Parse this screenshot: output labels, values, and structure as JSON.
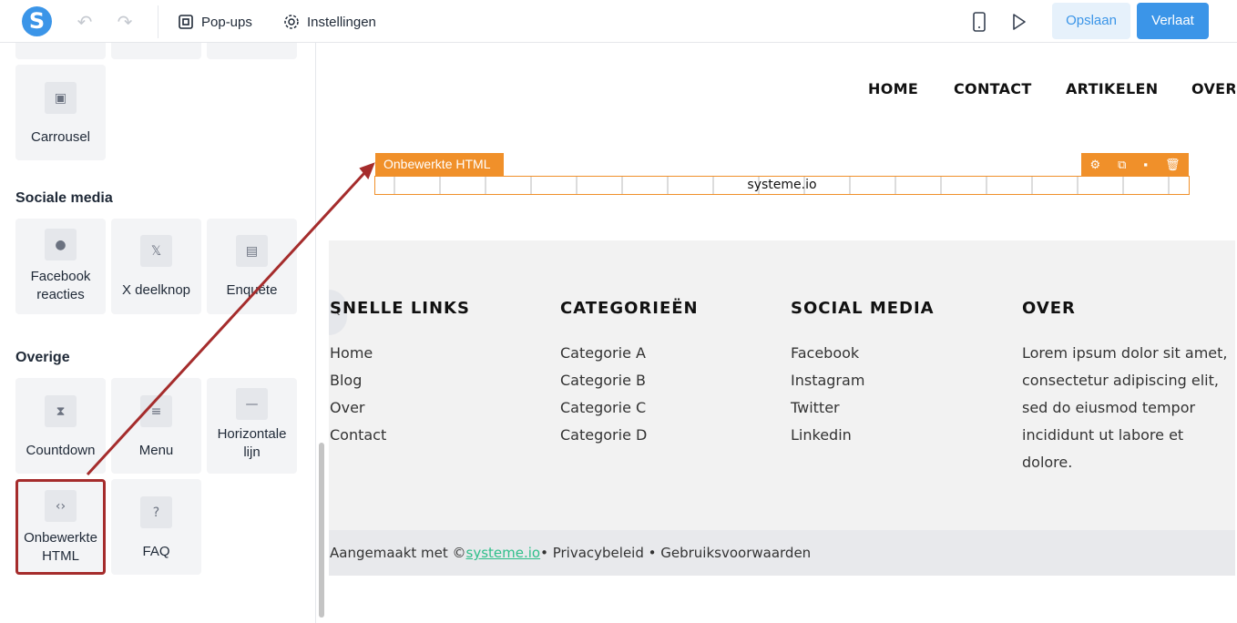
{
  "topbar": {
    "logo_letter": "S",
    "popups_label": "Pop-ups",
    "settings_label": "Instellingen",
    "save_label": "Opslaan",
    "leave_label": "Verlaat"
  },
  "sidebar": {
    "carousel_label": "Carrousel",
    "social_title": "Sociale media",
    "social_items": [
      "Facebook reacties",
      "X deelknop",
      "Enquête"
    ],
    "other_title": "Overige",
    "other_items": [
      "Countdown",
      "Menu",
      "Horizontale lijn",
      "Onbewerkte HTML",
      "FAQ"
    ]
  },
  "canvas": {
    "nav": [
      "HOME",
      "CONTACT",
      "ARTIKELEN",
      "OVER"
    ],
    "html_element_tag": "Onbewerkte HTML",
    "html_element_text": "systeme.io",
    "footer": {
      "columns": [
        {
          "title": "SNELLE LINKS",
          "links": [
            "Home",
            "Blog",
            "Over",
            "Contact"
          ]
        },
        {
          "title": "CATEGORIEËN",
          "links": [
            "Categorie A",
            "Categorie B",
            "Categorie C",
            "Categorie D"
          ]
        },
        {
          "title": "SOCIAL MEDIA",
          "links": [
            "Facebook",
            "Instagram",
            "Twitter",
            "Linkedin"
          ]
        },
        {
          "title": "OVER",
          "text": [
            "Lorem ipsum dolor sit amet,",
            "consectetur adipiscing elit,",
            "sed do eiusmod tempor",
            "incididunt ut labore et",
            "dolore."
          ]
        }
      ],
      "bottom_prefix": "Aangemaakt met ©",
      "bottom_link": "systeme.io",
      "bottom_suffix": "• Privacybeleid • Gebruiksvoorwaarden"
    }
  },
  "colors": {
    "accent": "#3b95e8",
    "html_element": "#f0902a",
    "highlight": "#a52c2c"
  }
}
